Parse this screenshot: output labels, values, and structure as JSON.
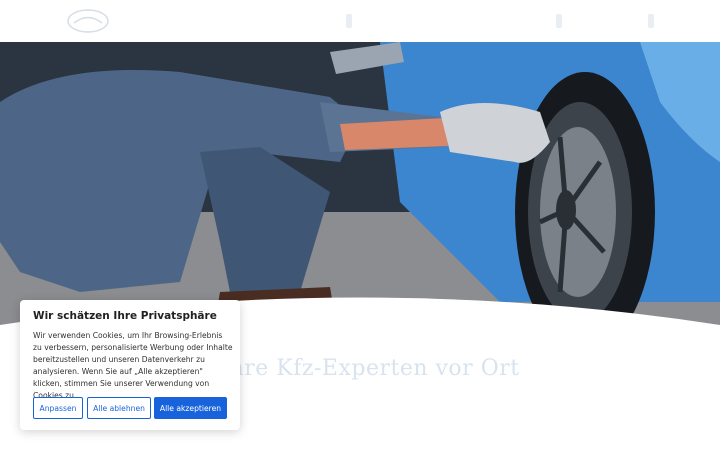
{
  "header": {
    "logo_icon": "car-badge-icon"
  },
  "hero": {
    "image_icon": "mechanic-tire-photo",
    "headline": "Ihre Kfz-Experten vor Ort"
  },
  "cookie_banner": {
    "title": "Wir schätzen Ihre Privatsphäre",
    "body": "Wir verwenden Cookies, um Ihr Browsing-Erlebnis zu verbessern, personalisierte Werbung oder Inhalte bereitzustellen und unseren Datenverkehr zu analysieren. Wenn Sie auf „Alle akzeptieren\" klicken, stimmen Sie unserer Verwendung von Cookies zu.",
    "buttons": {
      "customize": "Anpassen",
      "reject": "Alle ablehnen",
      "accept": "Alle akzeptieren"
    },
    "accent_color": "#1863dc"
  }
}
